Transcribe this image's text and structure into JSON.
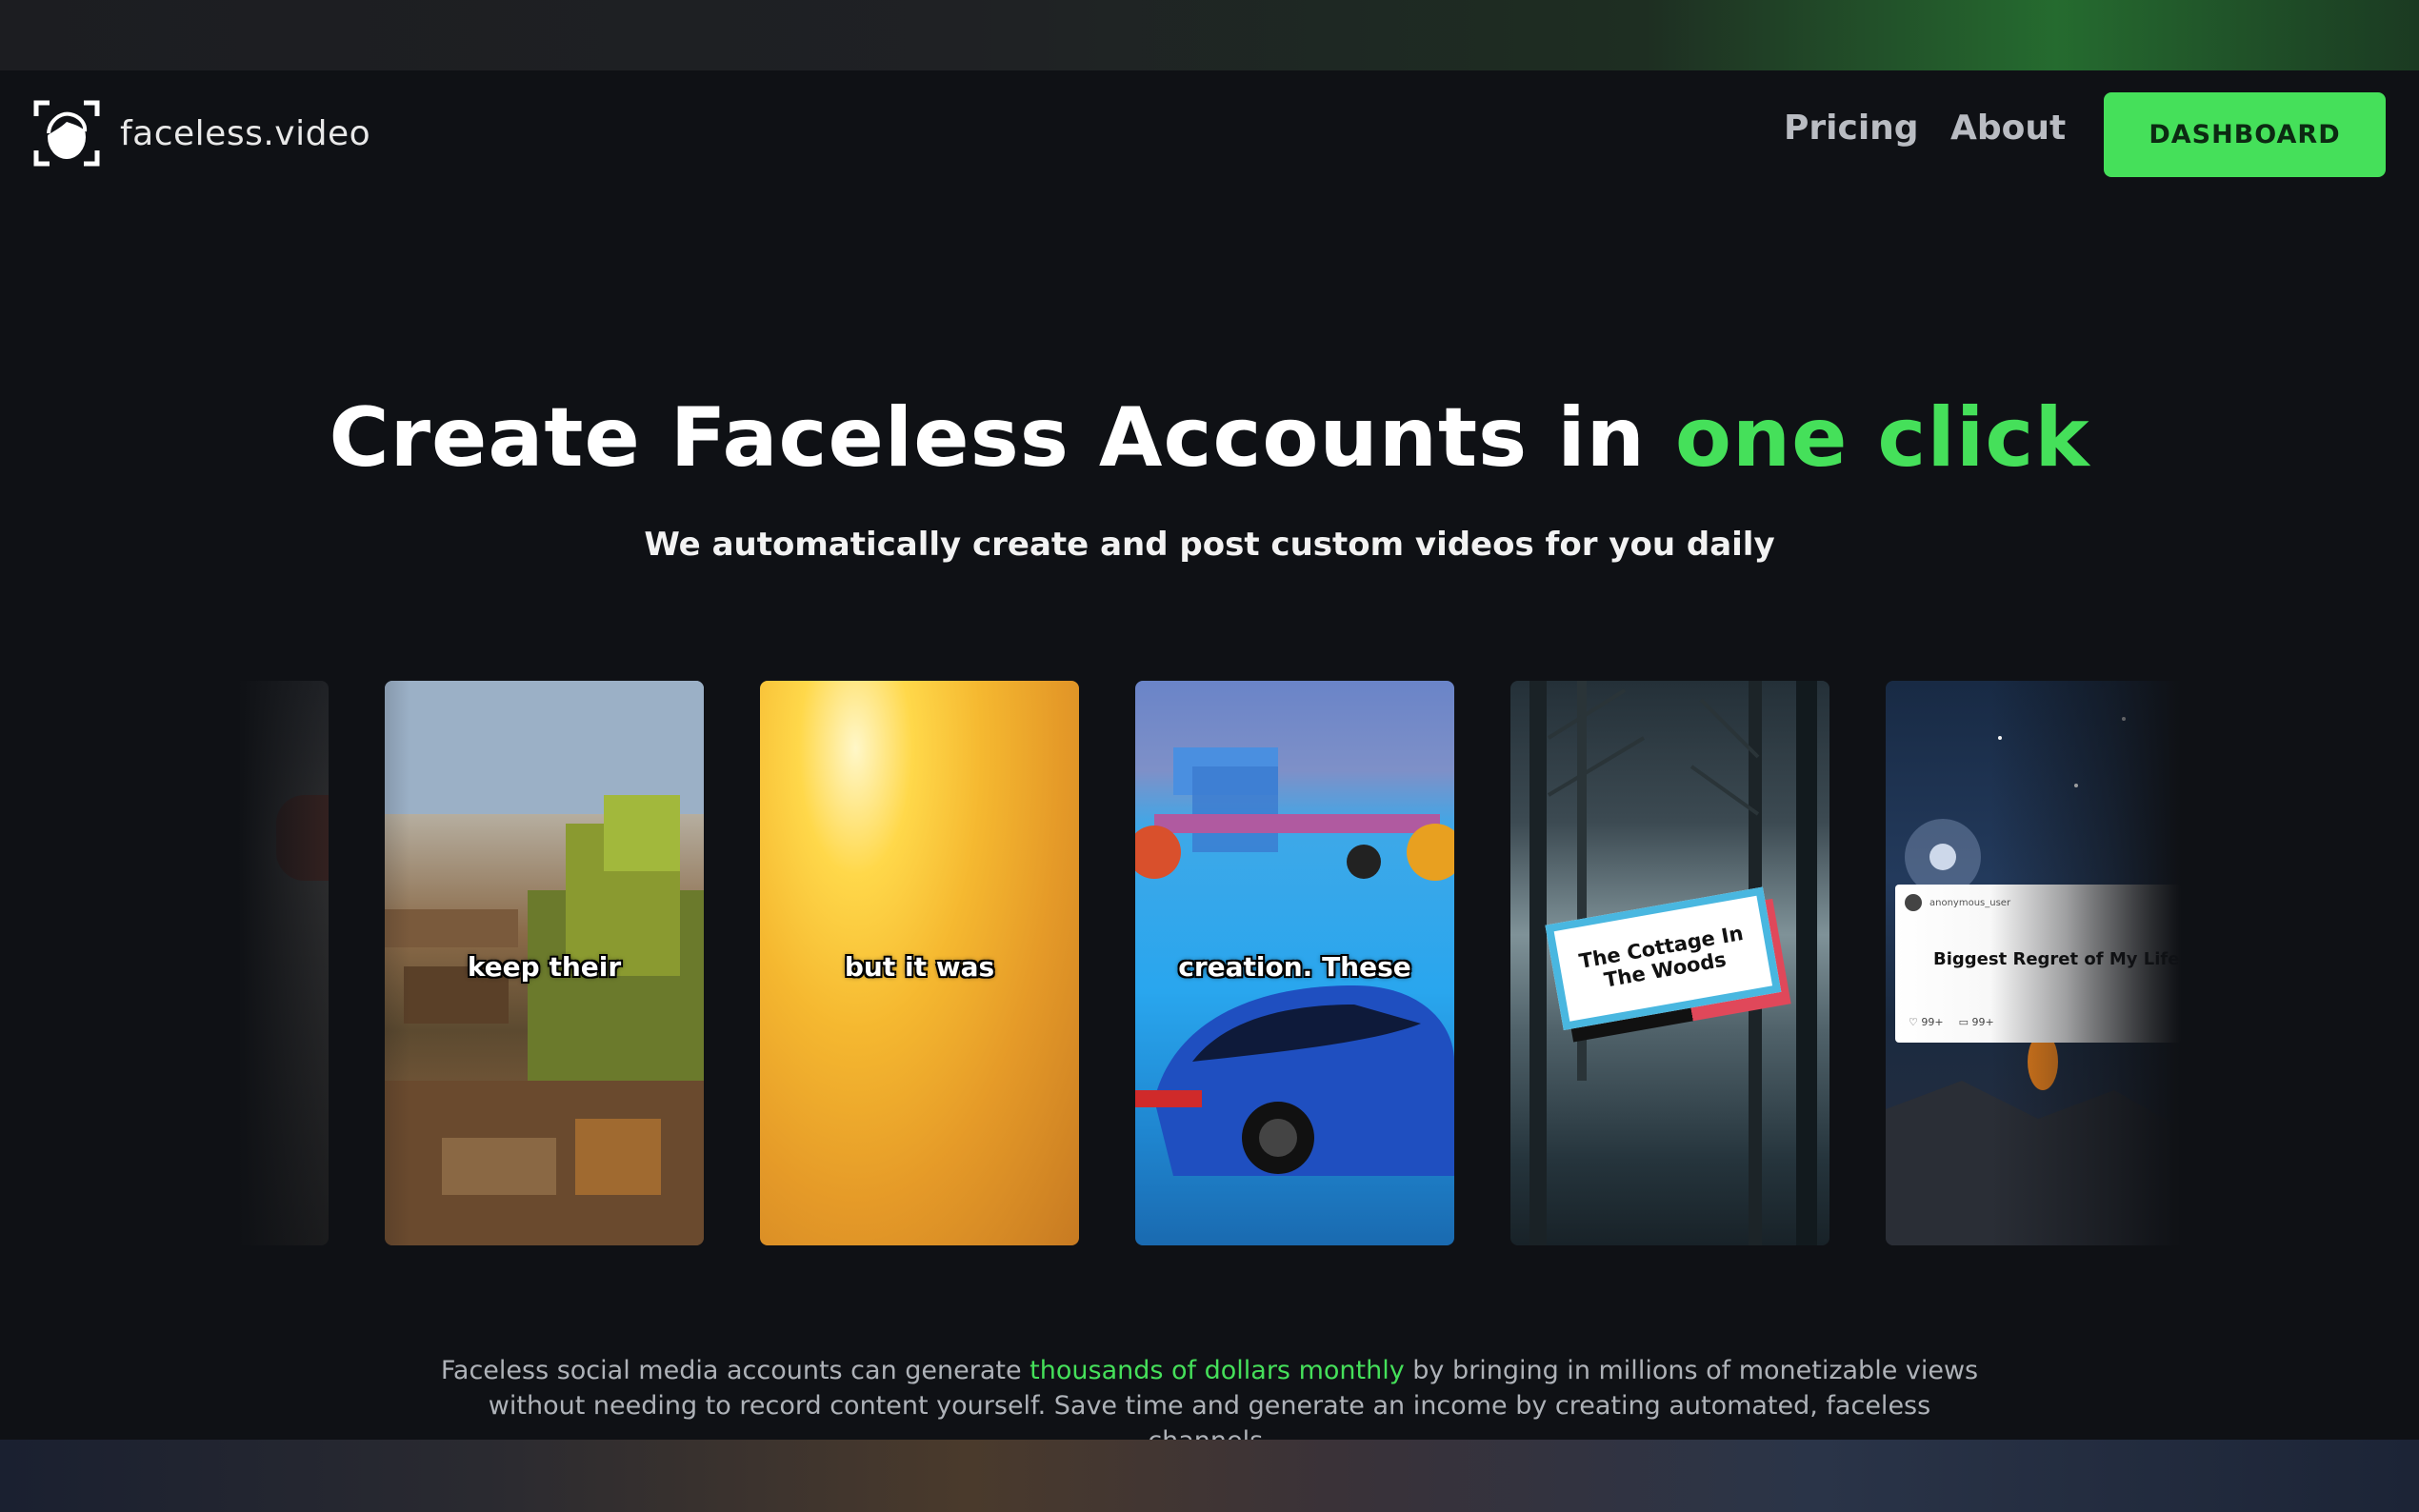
{
  "brand": {
    "name": "faceless.video",
    "logo_icon": "face-scan-icon"
  },
  "nav": {
    "pricing": "Pricing",
    "about": "About",
    "dashboard": "DASHBOARD"
  },
  "hero": {
    "title_main": "Create Faceless Accounts in ",
    "title_accent": "one click",
    "subtitle": "We automatically create and post custom videos for you daily"
  },
  "videos": [
    {
      "caption": "keep their"
    },
    {
      "caption": "but it was"
    },
    {
      "caption": "creation. These"
    },
    {
      "caption": "The Cottage In The Woods"
    },
    {
      "username": "anonymous_user",
      "title": "Biggest Regret of My Life",
      "likes": "99+",
      "comments": "99+"
    }
  ],
  "blurb": {
    "part1": "Faceless social media accounts can generate ",
    "highlight": "thousands of dollars monthly",
    "part2": " by bringing in millions of monetizable views without needing to record content yourself. Save time and generate an income by creating automated, faceless channels."
  },
  "colors": {
    "accent": "#45e05a",
    "background": "#0f1115",
    "nav_text": "#b9bcc2"
  }
}
